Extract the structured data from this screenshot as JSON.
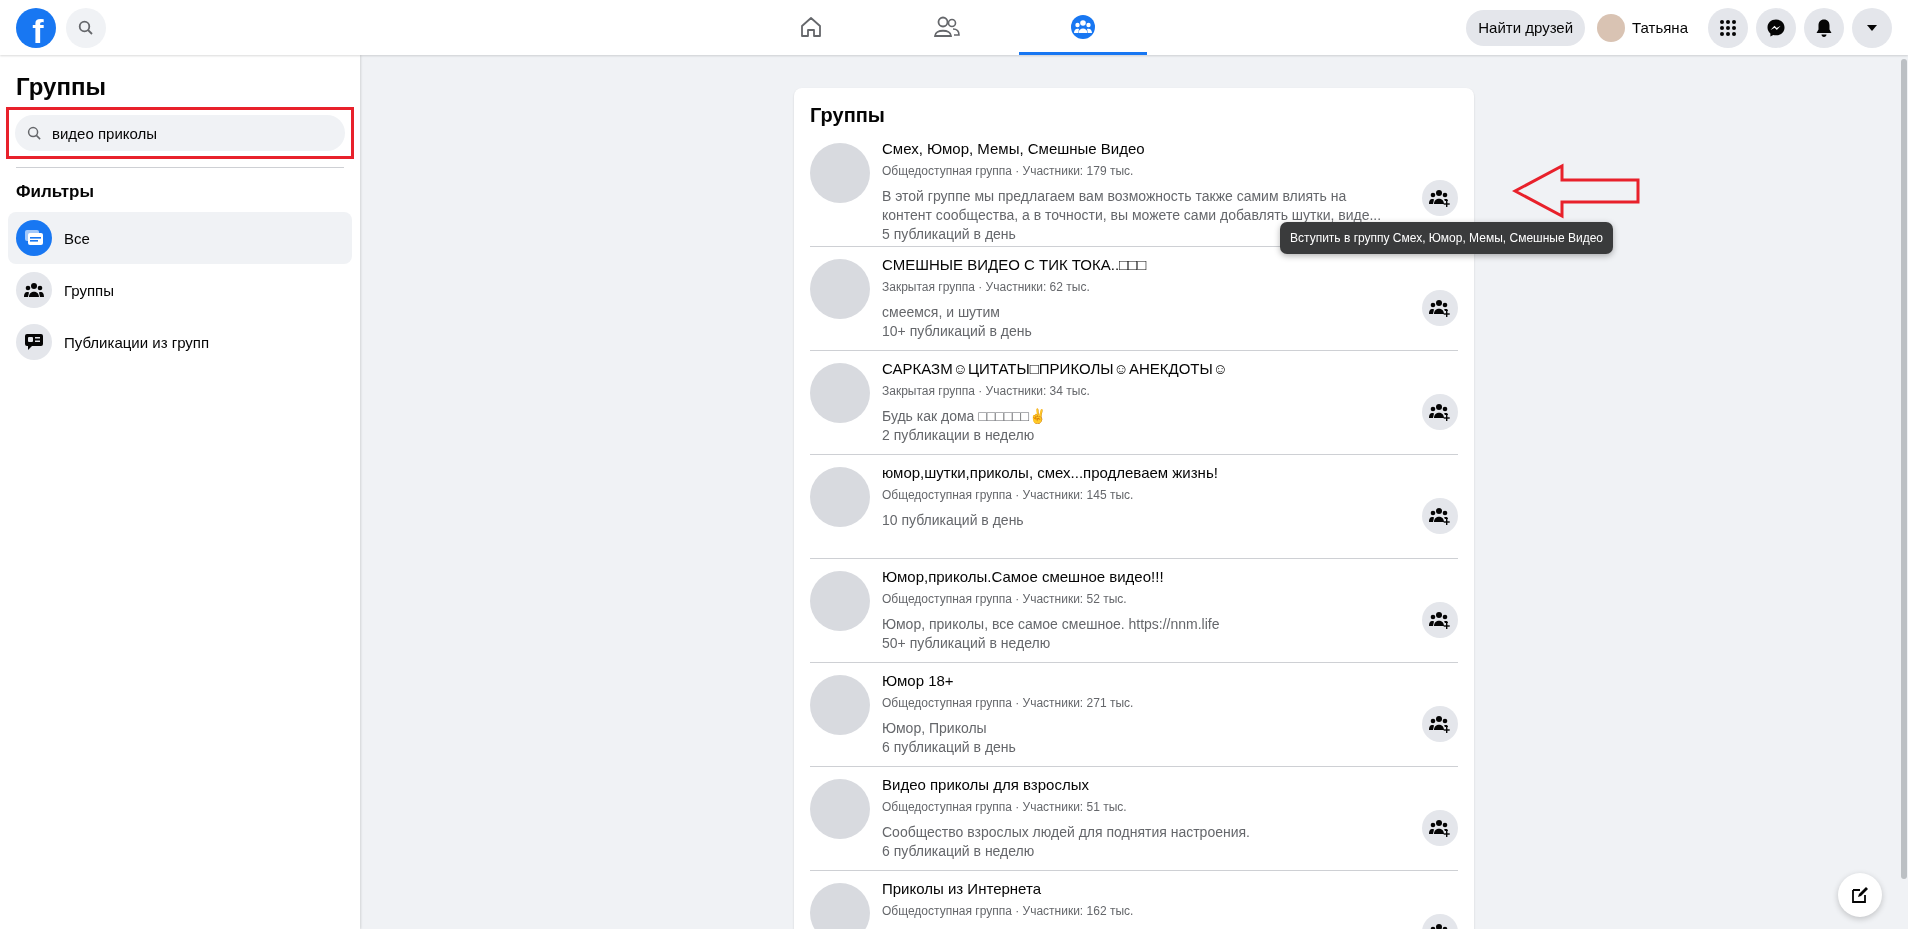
{
  "topbar": {
    "logo": "f",
    "nav_tabs": [
      {
        "kind": "home",
        "selected": false
      },
      {
        "kind": "friends",
        "selected": false
      },
      {
        "kind": "groups",
        "selected": true
      }
    ],
    "find_friends": "Найти друзей",
    "user_name": "Татьяна"
  },
  "sidebar": {
    "title": "Группы",
    "search": {
      "value": "видео приколы",
      "highlighted": true
    },
    "filters_title": "Фильтры",
    "filters": [
      {
        "label": "Все",
        "kind": "all",
        "selected": true
      },
      {
        "label": "Группы",
        "kind": "groups",
        "selected": false
      },
      {
        "label": "Публикации из групп",
        "kind": "posts",
        "selected": false
      }
    ]
  },
  "results": {
    "title": "Группы",
    "tooltip": "Вступить в группу Смех, Юмор, Мемы, Смешные Видео",
    "groups": [
      {
        "name": "Смех, Юмор, Мемы, Смешные Видео",
        "meta": "Общедоступная группа · Участники: 179 тыс.",
        "description": "В этой группе мы предлагаем вам возможность также самим влиять на контент сообщества, а в точности, вы можете сами добавлять шутки, виде...",
        "activity": "5 публикаций в день"
      },
      {
        "name": "СМЕШНЫЕ ВИДЕО С ТИК ТОКА..□□□",
        "meta": "Закрытая группа · Участники: 62 тыс.",
        "description": "смеемся, и шутим",
        "activity": "10+ публикаций в день"
      },
      {
        "name": "САРКАЗМ☺ЦИТАТЫ□ПРИКОЛЫ☺АНЕКДОТЫ☺",
        "meta": "Закрытая группа · Участники: 34 тыс.",
        "description": "Будь как дома □□□□□□✌",
        "activity": "2 публикации в неделю"
      },
      {
        "name": "юмор,шутки,приколы, смех...продлеваем жизнь!",
        "meta": "Общедоступная группа · Участники: 145 тыс.",
        "activity": "10 публикаций в день"
      },
      {
        "name": "Юмор,приколы.Самое смешное видео!!!",
        "meta": "Общедоступная группа · Участники: 52 тыс.",
        "description": "Юмор, приколы, все самое смешное. https://nnm.life",
        "activity": "50+ публикаций в неделю"
      },
      {
        "name": "Юмор 18+",
        "meta": "Общедоступная группа · Участники: 271 тыс.",
        "description": "Юмор, Приколы",
        "activity": "6 публикаций в день"
      },
      {
        "name": "Видео приколы для взрослых",
        "meta": "Общедоступная группа · Участники: 51 тыс.",
        "description": "Сообщество взрослых людей для поднятия настроения.",
        "activity": "6 публикаций в неделю"
      },
      {
        "name": "Приколы из Интернета",
        "meta": "Общедоступная группа · Участники: 162 тыс."
      }
    ]
  }
}
